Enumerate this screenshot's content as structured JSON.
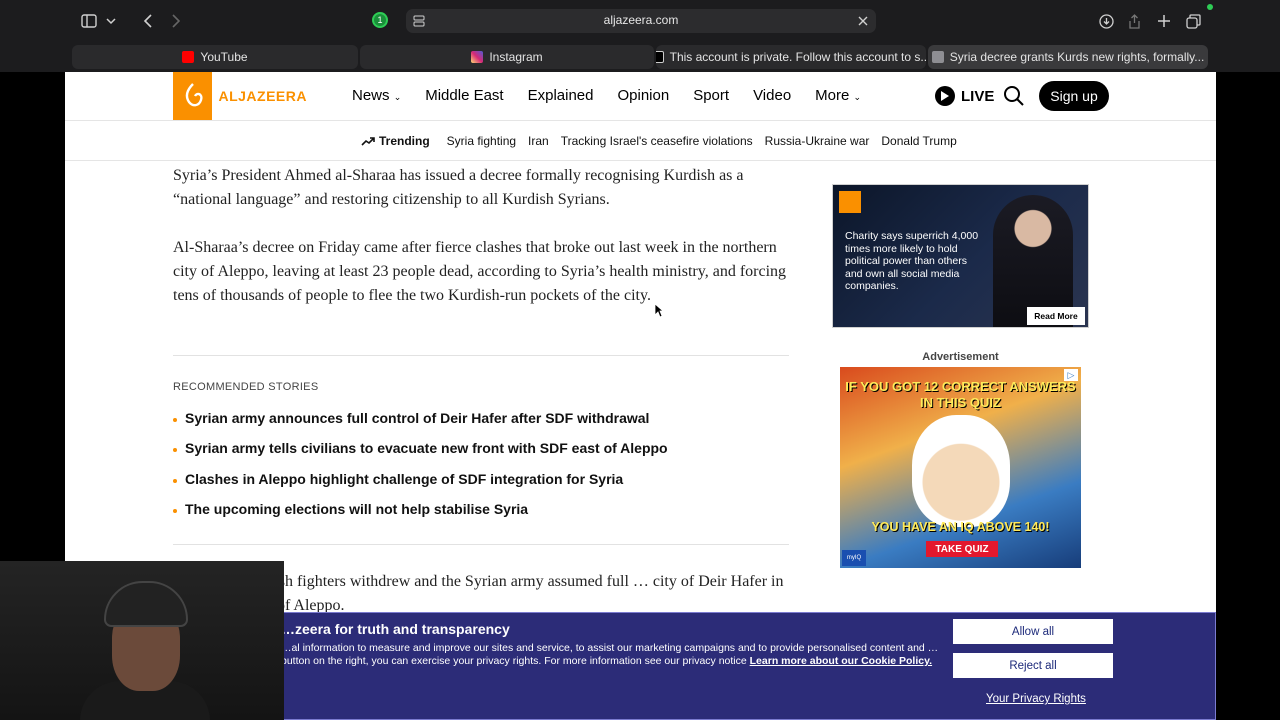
{
  "browser": {
    "url": "aljazeera.com",
    "extension_badge": "1",
    "tabs": [
      {
        "label": "YouTube",
        "color": "#ff0000"
      },
      {
        "label": "Instagram",
        "color": "#d6249f"
      },
      {
        "label": "This account is private. Follow this account to s...",
        "color": "#ffffff"
      },
      {
        "label": "Syria decree grants Kurds new rights, formally...",
        "color": "#8e8e93",
        "active": true
      }
    ]
  },
  "header": {
    "logo_text": "ALJAZEERA",
    "nav": [
      "News",
      "Middle East",
      "Explained",
      "Opinion",
      "Sport",
      "Video",
      "More"
    ],
    "live": "LIVE",
    "signup": "Sign up"
  },
  "trending": {
    "label": "Trending",
    "items": [
      "Syria fighting",
      "Iran",
      "Tracking Israel's ceasefire violations",
      "Russia-Ukraine war",
      "Donald Trump"
    ]
  },
  "article": {
    "p1": "Syria’s President Ahmed al-Sharaa has issued a decree formally recognising Kurdish as a “national language” and restoring citizenship to all Kurdish Syrians.",
    "p2": "Al-Sharaa’s decree on Friday came after fierce clashes that broke out last week in the northern city of Aleppo, leaving at least 23 people dead, according to Syria’s health ministry, and forcing tens of thousands of people to flee the two Kurdish-run pockets of the city.",
    "p3": "…ed after Kurdish fighters withdrew and the Syrian army assumed full … city of Deir Hafer in the governorate of Aleppo."
  },
  "recommended": {
    "heading": "RECOMMENDED STORIES",
    "items": [
      "Syrian army announces full control of Deir Hafer after SDF withdrawal",
      "Syrian army tells civilians to evacuate new front with SDF east of Aleppo",
      "Clashes in Aleppo highlight challenge of SDF integration for Syria",
      "The upcoming elections will not help stabilise Syria"
    ]
  },
  "ads": {
    "ad1_text": "Charity says superrich 4,000 times more likely to hold political power than others and own all social media companies.",
    "ad1_button": "Read More",
    "label": "Advertisement",
    "ad2_top": "IF YOU GOT 12 CORRECT ANSWERS IN THIS QUIZ",
    "ad2_mid": "YOU HAVE AN IQ ABOVE 140!",
    "ad2_button": "TAKE QUIZ",
    "ad2_brand": "myIQ"
  },
  "cookie": {
    "title": "…zeera for truth and transparency",
    "body": "…al information to measure and improve our sites and service, to assist our marketing campaigns and to provide personalised content and … button on the right, you can exercise your privacy rights. For more information see our privacy notice",
    "link": "Learn more about our Cookie Policy.",
    "allow": "Allow all",
    "reject": "Reject all",
    "privacy": "Your Privacy Rights"
  },
  "colors": {
    "brand": "#fa9000",
    "cookie_bg": "#2c2c78"
  }
}
